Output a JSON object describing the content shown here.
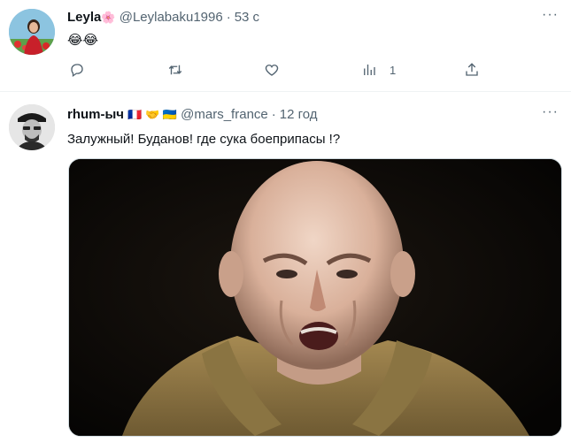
{
  "tweets": [
    {
      "name": "Leyla",
      "name_emoji": "🌸",
      "handle": "@Leylabaku1996",
      "time": "53 с",
      "text": "😂😂",
      "actions": {
        "reply_icon": "reply-icon",
        "retweet_icon": "retweet-icon",
        "like_icon": "like-icon",
        "views_icon": "views-icon",
        "views_count": "1",
        "share_icon": "share-icon"
      }
    },
    {
      "name": "rhum-ыч",
      "name_flags": "🇫🇷 🤝 🇺🇦",
      "handle": "@mars_france",
      "time": "12 год",
      "text": "Залужный! Буданов! где сука боеприпасы !?"
    }
  ],
  "colors": {
    "muted": "#536471",
    "divider": "#eff3f4"
  }
}
